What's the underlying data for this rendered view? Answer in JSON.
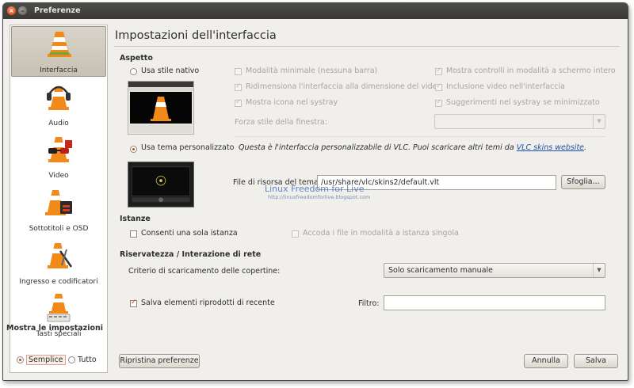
{
  "window": {
    "title": "Preferenze"
  },
  "sidebar": {
    "items": [
      {
        "label": "Interfaccia",
        "icon": "vlc-cone-icon"
      },
      {
        "label": "Audio",
        "icon": "vlc-headphones-icon"
      },
      {
        "label": "Video",
        "icon": "vlc-glasses-icon"
      },
      {
        "label": "Sottotitoli e OSD",
        "icon": "vlc-subtitles-icon"
      },
      {
        "label": "Ingresso e codificatori",
        "icon": "vlc-input-icon"
      },
      {
        "label": "Tasti speciali",
        "icon": "vlc-hotkeys-icon"
      }
    ],
    "mostra_label": "Mostra le impostazioni",
    "semplice_label": "Semplice",
    "tutto_label": "Tutto"
  },
  "main": {
    "title": "Impostazioni dell'interfaccia",
    "aspetto": {
      "heading": "Aspetto",
      "native_label": "Usa stile nativo",
      "opt_minimal": "Modalità minimale (nessuna barra)",
      "opt_resize": "Ridimensiona l'interfaccia alla dimensione del video",
      "opt_systray": "Mostra icona nel systray",
      "opt_fullscreen_ctrl": "Mostra controlli in modalità a schermo intero",
      "opt_embed": "Inclusione video nell'interfaccia",
      "opt_systray_hints": "Suggerimenti nel systray se minimizzato",
      "force_style_label": "Forza stile della finestra:",
      "force_style_value": "",
      "custom_label": "Usa tema personalizzato",
      "custom_desc": "Questa è l'interfaccia personalizzabile di VLC. Puoi scaricare altri temi da",
      "custom_link": "VLC skins website",
      "skin_file_label": "File di risorsa del tema:",
      "skin_file_value": "/usr/share/vlc/skins2/default.vlt",
      "browse_label": "Sfoglia..."
    },
    "istanze": {
      "heading": "Istanze",
      "single_label": "Consenti una sola istanza",
      "enqueue_label": "Accoda i file in modalità a istanza singola"
    },
    "privacy": {
      "heading": "Riservatezza / Interazione di rete",
      "covers_label": "Criterio di scaricamento delle copertine:",
      "covers_value": "Solo scaricamento manuale",
      "recent_label": "Salva elementi riprodotti di recente",
      "filter_label": "Filtro:",
      "filter_value": ""
    },
    "watermark": "Linux Freedom for Live",
    "watermark_url": "http://linuxfreedomforlive.blogspot.com"
  },
  "footer": {
    "reset_label": "Ripristina preferenze",
    "cancel_label": "Annulla",
    "save_label": "Salva"
  },
  "colors": {
    "accent": "#d54412",
    "vlc_orange": "#f28a1a",
    "link": "#1d4fa8"
  }
}
